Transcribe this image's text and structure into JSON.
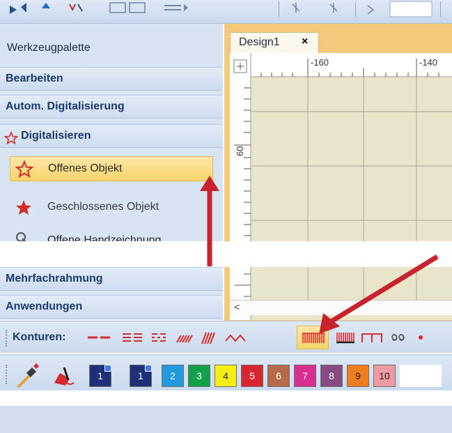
{
  "palette": {
    "title": "Werkzeugpalette",
    "categories": {
      "bearbeiten": "Bearbeiten",
      "autodigitizing": "Autom. Digitalisierung",
      "digitalisieren": "Digitalisieren",
      "multihoop": "Mehrfachrahmung",
      "applications": "Anwendungen"
    },
    "tools": [
      {
        "label": "Offenes Objekt",
        "icon": "open-object-star-icon",
        "active": true
      },
      {
        "label": "Geschlossenes Objekt",
        "icon": "closed-object-star-icon",
        "active": false
      },
      {
        "label": "Offene Handzeichnung",
        "icon": "freehand-icon",
        "active": false
      }
    ]
  },
  "design": {
    "tab_label": "Design1",
    "close_glyph": "×",
    "ruler_top_labels": [
      "-160",
      "-140"
    ],
    "ruler_left_label": "60",
    "scroll_arrow": "<"
  },
  "contour_toolbar": {
    "label": "Konturen:",
    "active_button": "blanket-stitch-line",
    "accent_color": "#d62b2b"
  },
  "color_bar": {
    "swatches": [
      {
        "num": "1",
        "color": "#1f2f7a",
        "text": "#ffffff",
        "current": true
      },
      {
        "num": "1",
        "color": "#1f2f7a",
        "text": "#ffffff",
        "current": true
      },
      {
        "num": "2",
        "color": "#2399e0",
        "text": "#ffffff"
      },
      {
        "num": "3",
        "color": "#11a04a",
        "text": "#ffffff"
      },
      {
        "num": "4",
        "color": "#f5ee17",
        "text": "#222222"
      },
      {
        "num": "5",
        "color": "#d9252f",
        "text": "#ffffff"
      },
      {
        "num": "6",
        "color": "#b76a4b",
        "text": "#ffffff"
      },
      {
        "num": "7",
        "color": "#d92e8f",
        "text": "#ffffff"
      },
      {
        "num": "8",
        "color": "#874a84",
        "text": "#ffffff"
      },
      {
        "num": "9",
        "color": "#ef7d1d",
        "text": "#222222"
      },
      {
        "num": "10",
        "color": "#ee9aa2",
        "text": "#222222"
      }
    ]
  },
  "annotation_color": "#c8232c"
}
